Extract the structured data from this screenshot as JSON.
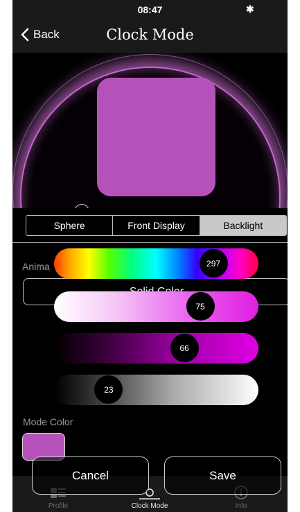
{
  "status_bar": {
    "time": "08:47",
    "bluetooth_icon": "bluetooth-icon"
  },
  "nav": {
    "back_label": "Back",
    "title": "Clock Mode"
  },
  "segments": [
    {
      "label": "Sphere",
      "active": false
    },
    {
      "label": "Front Display",
      "active": false
    },
    {
      "label": "Backlight",
      "active": true
    }
  ],
  "animation": {
    "label": "Animation",
    "visible_label": "Anima",
    "value": "Solid Color"
  },
  "sliders": [
    {
      "name": "hue",
      "value": "297",
      "fraction": 0.825
    },
    {
      "name": "saturation",
      "value": "75",
      "fraction": 0.75
    },
    {
      "name": "value",
      "value": "66",
      "fraction": 0.66
    },
    {
      "name": "brightness",
      "value": "23",
      "fraction": 0.23
    }
  ],
  "mode_color": {
    "label": "Mode Color",
    "color": "#b552b9"
  },
  "dialog": {
    "cancel": "Cancel",
    "save": "Save"
  },
  "tabs": [
    {
      "label": "Profile",
      "icon": "profile-icon",
      "active": false
    },
    {
      "label": "Clock Mode",
      "icon": "clock-mode-icon",
      "active": true
    },
    {
      "label": "Info",
      "icon": "info-icon",
      "active": false
    }
  ],
  "colors": {
    "accent": "#b552b9",
    "glow": "#c267c8",
    "background": "#000000"
  }
}
